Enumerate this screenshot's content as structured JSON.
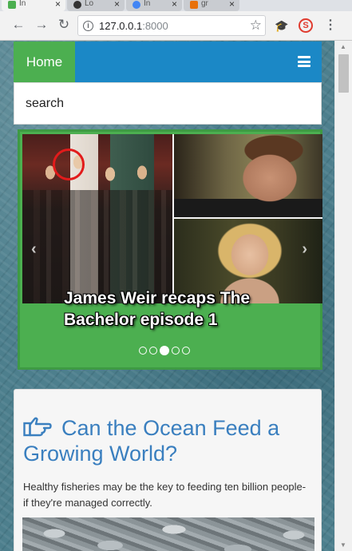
{
  "browser": {
    "tabs": [
      {
        "title": "In",
        "color": "#4caf50"
      },
      {
        "title": "Lo",
        "color": "#333333"
      },
      {
        "title": "In",
        "color": "#4285f4"
      },
      {
        "title": "gr",
        "color": "#e8710a"
      }
    ],
    "url_host": "127.0.0.1",
    "url_port": ":8000"
  },
  "site": {
    "nav": {
      "home_label": "Home"
    },
    "search": {
      "placeholder": "search"
    },
    "carousel": {
      "caption": "James Weir recaps The Bachelor episode 1",
      "slide_count": 5,
      "active_index": 2
    },
    "article": {
      "title": "Can the Ocean Feed a Growing World?",
      "summary": "Healthy fisheries may be the key to feeding ten billion people-if they're managed correctly."
    }
  },
  "colors": {
    "navbar": "#1b88c6",
    "home": "#4caf50",
    "carousel": "#4caf50",
    "title": "#3a7fbf"
  }
}
